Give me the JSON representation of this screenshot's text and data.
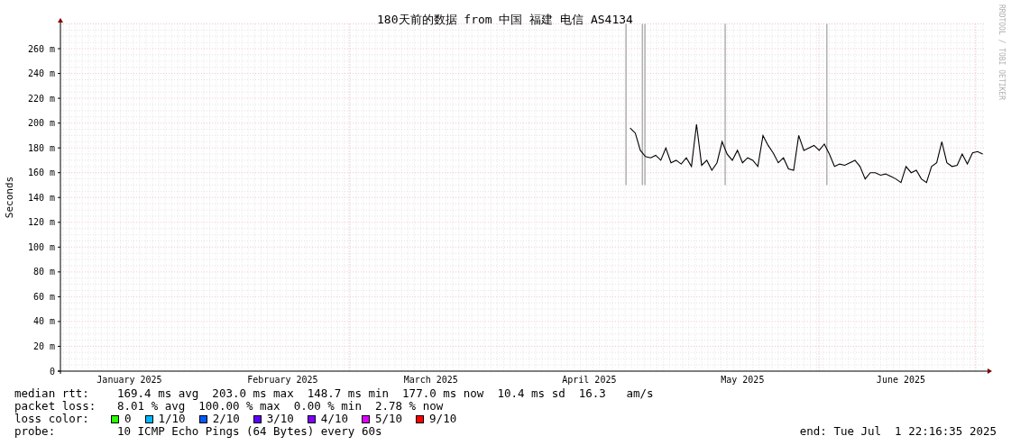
{
  "graph": {
    "watermark": "RRDTOOL / TOBI OETIKER",
    "chart_data": {
      "type": "line",
      "title": "180天前的数据 from 中国 福建 电信 AS4134",
      "ylabel": "Seconds",
      "ylim": [
        0,
        280
      ],
      "yticks": [
        {
          "value": 0,
          "label": "0"
        },
        {
          "value": 20,
          "label": "20 m"
        },
        {
          "value": 40,
          "label": "40 m"
        },
        {
          "value": 60,
          "label": "60 m"
        },
        {
          "value": 80,
          "label": "80 m"
        },
        {
          "value": 100,
          "label": "100 m"
        },
        {
          "value": 120,
          "label": "120 m"
        },
        {
          "value": 140,
          "label": "140 m"
        },
        {
          "value": 160,
          "label": "160 m"
        },
        {
          "value": 180,
          "label": "180 m"
        },
        {
          "value": 200,
          "label": "200 m"
        },
        {
          "value": 220,
          "label": "220 m"
        },
        {
          "value": 240,
          "label": "240 m"
        },
        {
          "value": 260,
          "label": "260 m"
        }
      ],
      "categories": [
        null,
        null,
        null,
        null,
        null,
        null,
        null,
        null,
        null,
        null,
        null,
        null,
        null,
        "January 2025",
        null,
        null,
        null,
        null,
        null,
        null,
        null,
        null,
        null,
        null,
        null,
        null,
        null,
        null,
        null,
        null,
        null,
        null,
        null,
        null,
        null,
        null,
        null,
        null,
        null,
        null,
        null,
        null,
        null,
        "February 2025",
        null,
        null,
        null,
        null,
        null,
        null,
        null,
        null,
        null,
        null,
        null,
        null,
        null,
        null,
        null,
        null,
        null,
        null,
        null,
        null,
        null,
        null,
        null,
        null,
        null,
        null,
        null,
        null,
        "March 2025",
        null,
        null,
        null,
        null,
        null,
        null,
        null,
        null,
        null,
        null,
        null,
        null,
        null,
        null,
        null,
        null,
        null,
        null,
        null,
        null,
        null,
        null,
        null,
        null,
        null,
        null,
        null,
        null,
        null,
        null,
        "April 2025",
        null,
        null,
        null,
        null,
        null,
        null,
        null,
        null,
        null,
        null,
        null,
        null,
        null,
        null,
        null,
        null,
        null,
        null,
        null,
        null,
        null,
        null,
        null,
        null,
        null,
        null,
        null,
        null,
        null,
        "May 2025",
        null,
        null,
        null,
        null,
        null,
        null,
        null,
        null,
        null,
        null,
        null,
        null,
        null,
        null,
        null,
        null,
        null,
        null,
        null,
        null,
        null,
        null,
        null,
        null,
        null,
        null,
        null,
        null,
        null,
        null,
        "June 2025",
        null,
        null,
        null,
        null,
        null,
        null,
        null,
        null,
        null,
        null,
        null,
        null,
        null,
        null,
        null,
        null
      ],
      "series": [
        {
          "color": "#000000",
          "values": [
            null,
            null,
            null,
            null,
            null,
            null,
            null,
            null,
            null,
            null,
            null,
            null,
            null,
            null,
            null,
            null,
            null,
            null,
            null,
            null,
            null,
            null,
            null,
            null,
            null,
            null,
            null,
            null,
            null,
            null,
            null,
            null,
            null,
            null,
            null,
            null,
            null,
            null,
            null,
            null,
            null,
            null,
            null,
            null,
            null,
            null,
            null,
            null,
            null,
            null,
            null,
            null,
            null,
            null,
            null,
            null,
            null,
            null,
            null,
            null,
            null,
            null,
            null,
            null,
            null,
            null,
            null,
            null,
            null,
            null,
            null,
            null,
            null,
            null,
            null,
            null,
            null,
            null,
            null,
            null,
            null,
            null,
            null,
            null,
            null,
            null,
            null,
            null,
            null,
            null,
            null,
            null,
            null,
            null,
            null,
            null,
            null,
            null,
            null,
            null,
            null,
            null,
            null,
            null,
            null,
            null,
            null,
            null,
            null,
            null,
            null,
            196,
            192,
            178,
            173,
            172,
            174,
            170,
            180,
            168,
            170,
            167,
            172,
            165,
            199,
            166,
            170,
            162,
            168,
            185,
            175,
            170,
            178,
            168,
            172,
            170,
            165,
            190,
            182,
            176,
            168,
            172,
            163,
            162,
            190,
            178,
            180,
            182,
            178,
            183,
            175,
            165,
            167,
            166,
            168,
            170,
            165,
            155,
            160,
            160,
            158,
            159,
            157,
            155,
            152,
            165,
            160,
            162,
            155,
            152,
            165,
            168,
            185,
            168,
            165,
            166,
            175,
            167,
            176,
            177,
            175
          ]
        }
      ],
      "grid": true
    }
  },
  "legend": {
    "rows": [
      {
        "label": "median rtt:",
        "text": "169.4 ms avg  203.0 ms max  148.7 ms min  177.0 ms now  10.4 ms sd  16.3   am/s"
      },
      {
        "label": "packet loss:",
        "text": "8.01 % avg  100.00 % max  0.00 % min  2.78 % now"
      }
    ],
    "loss_color": {
      "label": "loss color:",
      "items": [
        {
          "label": "0",
          "color": "#26ff00"
        },
        {
          "label": "1/10",
          "color": "#00b8ff"
        },
        {
          "label": "2/10",
          "color": "#0059ff"
        },
        {
          "label": "3/10",
          "color": "#5e00ff"
        },
        {
          "label": "4/10",
          "color": "#7e00ff"
        },
        {
          "label": "5/10",
          "color": "#dd00ff"
        },
        {
          "label": "9/10",
          "color": "#ff0000"
        }
      ]
    },
    "probe": {
      "label": "probe:",
      "text": "10 ICMP Echo Pings (64 Bytes) every 60s"
    },
    "end": "end: Tue Jul  1 22:16:35 2025"
  }
}
